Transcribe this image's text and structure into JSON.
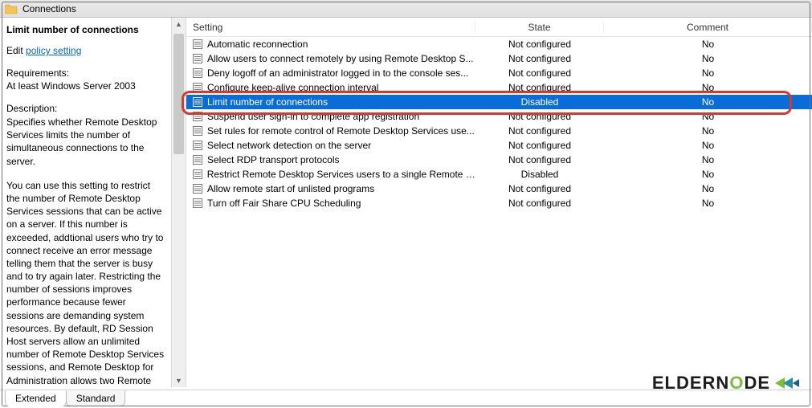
{
  "window": {
    "title": "Connections"
  },
  "left": {
    "heading": "Limit number of connections",
    "edit_prefix": "Edit ",
    "edit_link": "policy setting",
    "requirements_label": "Requirements:",
    "requirements_value": "At least Windows Server 2003",
    "description_label": "Description:",
    "description_para1": "Specifies whether Remote Desktop Services limits the number of simultaneous connections to the server.",
    "description_para2": "You can use this setting to restrict the number of Remote Desktop Services sessions that can be active on a server. If this number is exceeded, addtional users who try to connect receive an error message telling them that the server is busy and to try again later. Restricting the number of sessions improves performance because fewer sessions are demanding system resources. By default, RD Session Host servers allow an unlimited number of Remote Desktop Services sessions, and Remote Desktop for Administration allows two Remote"
  },
  "columns": {
    "setting": "Setting",
    "state": "State",
    "comment": "Comment"
  },
  "rows": [
    {
      "setting": "Automatic reconnection",
      "state": "Not configured",
      "comment": "No",
      "selected": false
    },
    {
      "setting": "Allow users to connect remotely by using Remote Desktop S...",
      "state": "Not configured",
      "comment": "No",
      "selected": false
    },
    {
      "setting": "Deny logoff of an administrator logged in to the console ses...",
      "state": "Not configured",
      "comment": "No",
      "selected": false
    },
    {
      "setting": "Configure keep-alive connection interval",
      "state": "Not configured",
      "comment": "No",
      "selected": false
    },
    {
      "setting": "Limit number of connections",
      "state": "Disabled",
      "comment": "No",
      "selected": true
    },
    {
      "setting": "Suspend user sign-in to complete app registration",
      "state": "Not configured",
      "comment": "No",
      "selected": false
    },
    {
      "setting": "Set rules for remote control of Remote Desktop Services use...",
      "state": "Not configured",
      "comment": "No",
      "selected": false
    },
    {
      "setting": "Select network detection on the server",
      "state": "Not configured",
      "comment": "No",
      "selected": false
    },
    {
      "setting": "Select RDP transport protocols",
      "state": "Not configured",
      "comment": "No",
      "selected": false
    },
    {
      "setting": "Restrict Remote Desktop Services users to a single Remote D...",
      "state": "Disabled",
      "comment": "No",
      "selected": false
    },
    {
      "setting": "Allow remote start of unlisted programs",
      "state": "Not configured",
      "comment": "No",
      "selected": false
    },
    {
      "setting": "Turn off Fair Share CPU Scheduling",
      "state": "Not configured",
      "comment": "No",
      "selected": false
    }
  ],
  "tabs": {
    "extended": "Extended",
    "standard": "Standard",
    "active": "extended"
  },
  "watermark": {
    "pre": "ELDERN",
    "o": "O",
    "post": "DE"
  }
}
